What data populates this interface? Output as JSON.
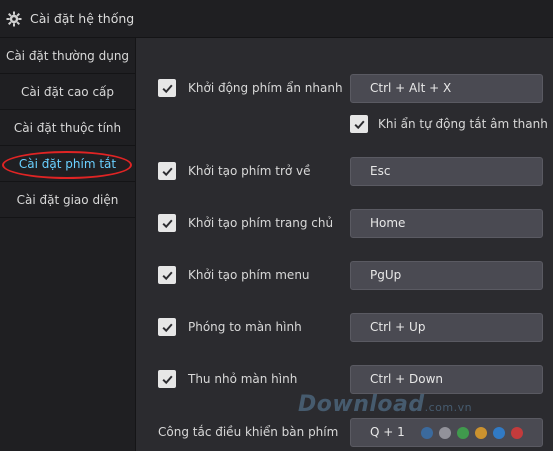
{
  "window": {
    "title": "Cài đặt hệ thống",
    "icon": "gear-icon"
  },
  "sidebar": {
    "items": [
      {
        "label": "Cài đặt thường dụng",
        "active": false
      },
      {
        "label": "Cài đặt cao cấp",
        "active": false
      },
      {
        "label": "Cài đặt thuộc tính",
        "active": false
      },
      {
        "label": "Cài đặt phím tắt",
        "active": true
      },
      {
        "label": "Cài đặt giao diện",
        "active": false
      }
    ]
  },
  "shortcuts": [
    {
      "label": "Khởi động phím ẩn nhanh",
      "checked": true,
      "key": "Ctrl + Alt + X"
    },
    {
      "label": "Khởi tạo phím trở về",
      "checked": true,
      "key": "Esc"
    },
    {
      "label": "Khởi tạo phím trang chủ",
      "checked": true,
      "key": "Home"
    },
    {
      "label": "Khởi tạo phím menu",
      "checked": true,
      "key": "PgUp"
    },
    {
      "label": "Phóng to màn hình",
      "checked": true,
      "key": "Ctrl + Up"
    },
    {
      "label": "Thu nhỏ màn hình",
      "checked": true,
      "key": "Ctrl + Down"
    }
  ],
  "mute_option": {
    "label": "Khi ẩn tự động tắt âm thanh",
    "checked": true
  },
  "remote_switch": {
    "label": "Công tắc điều khiển bàn phím",
    "key": "Q + 1",
    "dot_colors": [
      "#3a6ea5",
      "#9a9aa2",
      "#3fa34d",
      "#d99a2b",
      "#2f7fd0",
      "#d03a3a"
    ]
  },
  "watermark": {
    "text": "Download",
    "suffix": ".com.vn"
  },
  "colors": {
    "accent": "#6ad0ff",
    "highlight_circle": "#e02424"
  }
}
